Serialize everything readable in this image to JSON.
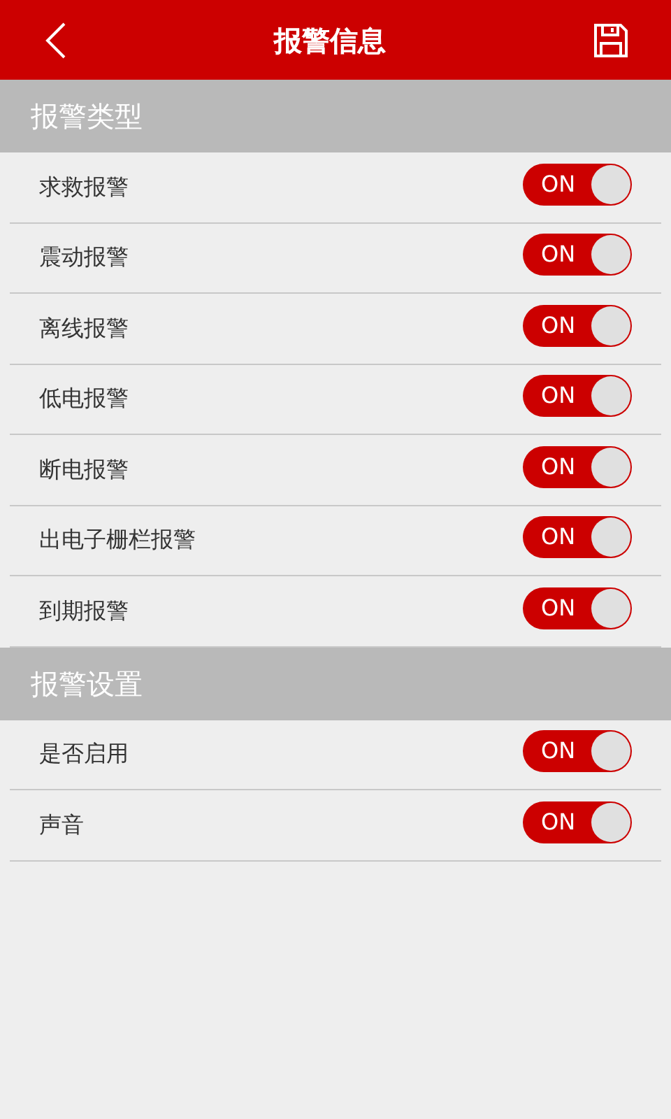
{
  "header": {
    "title": "报警信息"
  },
  "sections": [
    {
      "title": "报警类型",
      "rows": [
        {
          "label": "求救报警",
          "on": true,
          "switch_text": "ON"
        },
        {
          "label": "震动报警",
          "on": true,
          "switch_text": "ON"
        },
        {
          "label": "离线报警",
          "on": true,
          "switch_text": "ON"
        },
        {
          "label": "低电报警",
          "on": true,
          "switch_text": "ON"
        },
        {
          "label": "断电报警",
          "on": true,
          "switch_text": "ON"
        },
        {
          "label": "出电子栅栏报警",
          "on": true,
          "switch_text": "ON"
        },
        {
          "label": "到期报警",
          "on": true,
          "switch_text": "ON"
        }
      ]
    },
    {
      "title": "报警设置",
      "rows": [
        {
          "label": "是否启用",
          "on": true,
          "switch_text": "ON"
        },
        {
          "label": "声音",
          "on": true,
          "switch_text": "ON"
        }
      ]
    }
  ]
}
